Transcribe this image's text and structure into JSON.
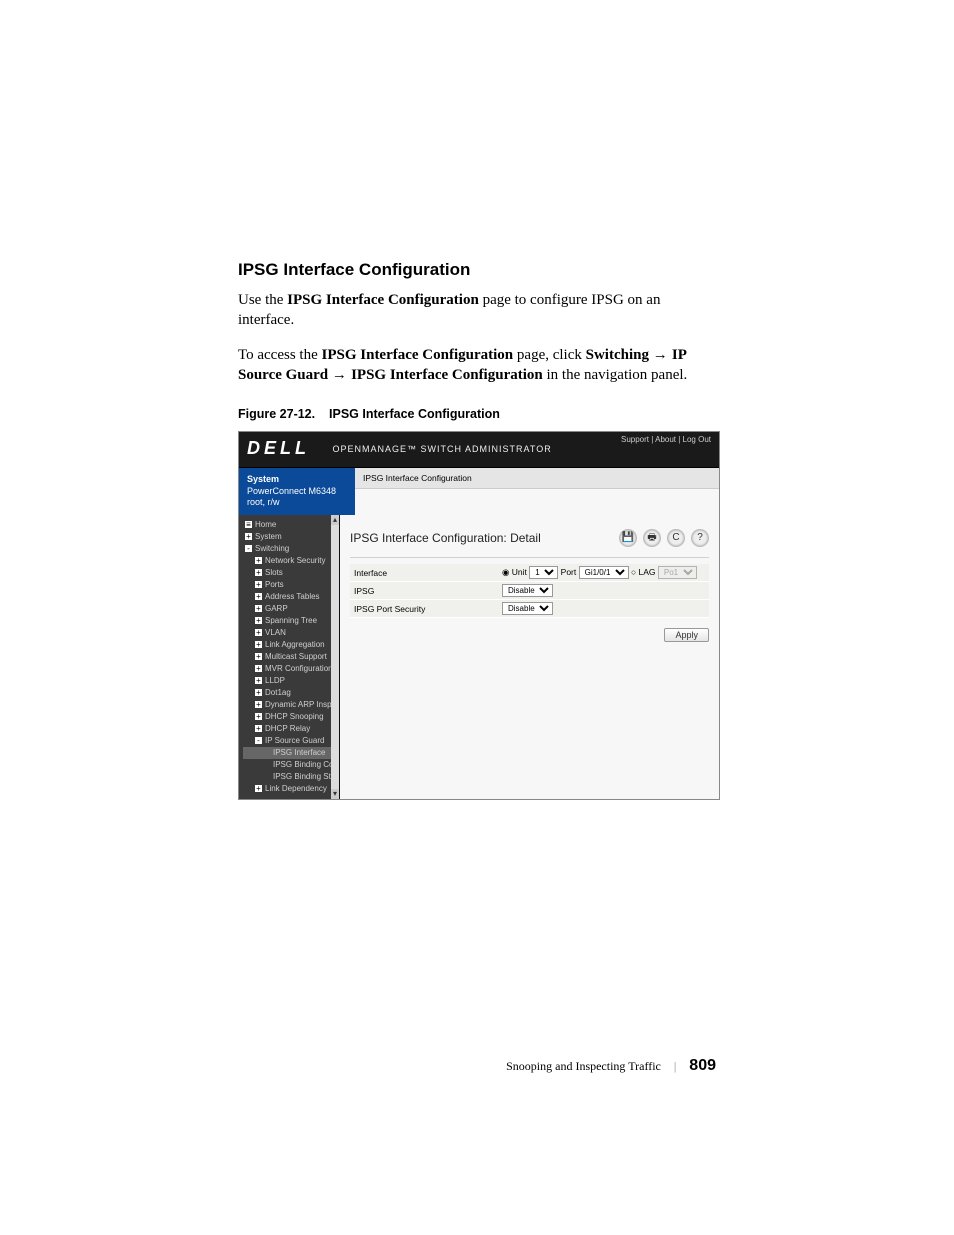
{
  "heading": "IPSG Interface Configuration",
  "intro": {
    "use_the": "Use the ",
    "bold_page": "IPSG Interface Configuration",
    "rest": " page to configure IPSG on an interface."
  },
  "access": {
    "pre": "To access the ",
    "b1": "IPSG Interface Configuration",
    "mid": " page, click ",
    "b2": "Switching",
    "arrow": " → ",
    "b3": "IP Source Guard",
    "b4": "IPSG Interface Configuration",
    "tail": " in the navigation panel."
  },
  "figure": {
    "label": "Figure 27-12.",
    "title": "IPSG Interface Configuration"
  },
  "shot": {
    "header_links": "Support | About | Log Out",
    "logo": "DELL",
    "admin_title": "OPENMANAGE™ SWITCH ADMINISTRATOR",
    "sysbox": {
      "line1": "System",
      "line2": "PowerConnect M6348",
      "line3": "root, r/w"
    },
    "crumb": "IPSG Interface Configuration",
    "detail_title": "IPSG Interface Configuration: Detail",
    "icons": {
      "save": "save-icon",
      "print": "print-icon",
      "refresh": "refresh-icon",
      "help": "help-icon"
    },
    "form": {
      "interface_label": "Interface",
      "unit_label": "Unit",
      "unit_value": "1",
      "port_label": "Port",
      "port_value": "Gi1/0/1",
      "lag_label": "LAG",
      "lag_value": "Po1",
      "ipsg_label": "IPSG",
      "ipsg_value": "Disable",
      "ipsg_ps_label": "IPSG Port Security",
      "ipsg_ps_value": "Disable",
      "apply": "Apply"
    },
    "nav": [
      {
        "label": "Home",
        "sign": "=",
        "cls": ""
      },
      {
        "label": "System",
        "sign": "+",
        "cls": ""
      },
      {
        "label": "Switching",
        "sign": "-",
        "cls": ""
      },
      {
        "label": "Network Security",
        "sign": "+",
        "cls": "sb-sub"
      },
      {
        "label": "Slots",
        "sign": "+",
        "cls": "sb-sub"
      },
      {
        "label": "Ports",
        "sign": "+",
        "cls": "sb-sub"
      },
      {
        "label": "Address Tables",
        "sign": "+",
        "cls": "sb-sub"
      },
      {
        "label": "GARP",
        "sign": "+",
        "cls": "sb-sub"
      },
      {
        "label": "Spanning Tree",
        "sign": "+",
        "cls": "sb-sub"
      },
      {
        "label": "VLAN",
        "sign": "+",
        "cls": "sb-sub"
      },
      {
        "label": "Link Aggregation",
        "sign": "+",
        "cls": "sb-sub"
      },
      {
        "label": "Multicast Support",
        "sign": "+",
        "cls": "sb-sub"
      },
      {
        "label": "MVR Configuration",
        "sign": "+",
        "cls": "sb-sub"
      },
      {
        "label": "LLDP",
        "sign": "+",
        "cls": "sb-sub"
      },
      {
        "label": "Dot1ag",
        "sign": "+",
        "cls": "sb-sub"
      },
      {
        "label": "Dynamic ARP Inspec",
        "sign": "+",
        "cls": "sb-sub"
      },
      {
        "label": "DHCP Snooping",
        "sign": "+",
        "cls": "sb-sub"
      },
      {
        "label": "DHCP Relay",
        "sign": "+",
        "cls": "sb-sub"
      },
      {
        "label": "IP Source Guard",
        "sign": "-",
        "cls": "sb-sub"
      },
      {
        "label": "IPSG Interface",
        "sign": "",
        "cls": "sb-sub3 sb-sel"
      },
      {
        "label": "IPSG Binding Co",
        "sign": "",
        "cls": "sb-sub3"
      },
      {
        "label": "IPSG Binding St",
        "sign": "",
        "cls": "sb-sub3"
      },
      {
        "label": "Link Dependency",
        "sign": "+",
        "cls": "sb-sub"
      }
    ]
  },
  "footer": {
    "section": "Snooping and Inspecting Traffic",
    "page": "809"
  }
}
